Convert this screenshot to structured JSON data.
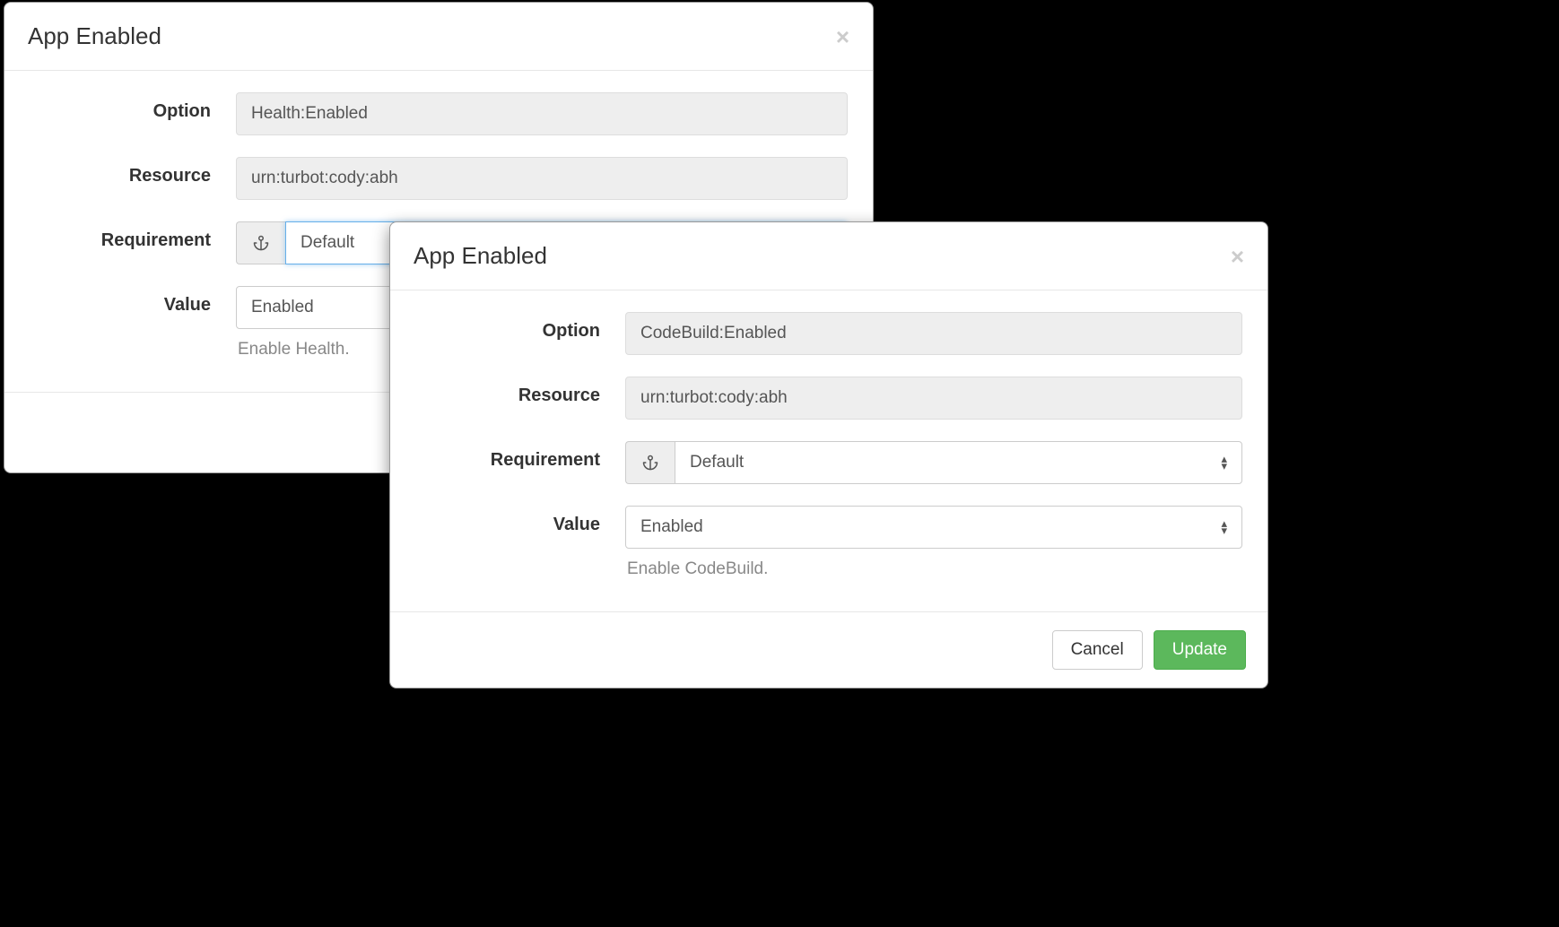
{
  "modal1": {
    "title": "App Enabled",
    "option_label": "Option",
    "option_value": "Health:Enabled",
    "resource_label": "Resource",
    "resource_value": "urn:turbot:cody:abh",
    "requirement_label": "Requirement",
    "requirement_value": "Default",
    "value_label": "Value",
    "value_value": "Enabled",
    "value_hint": "Enable Health."
  },
  "modal2": {
    "title": "App Enabled",
    "option_label": "Option",
    "option_value": "CodeBuild:Enabled",
    "resource_label": "Resource",
    "resource_value": "urn:turbot:cody:abh",
    "requirement_label": "Requirement",
    "requirement_value": "Default",
    "value_label": "Value",
    "value_value": "Enabled",
    "value_hint": "Enable CodeBuild.",
    "cancel_label": "Cancel",
    "update_label": "Update"
  }
}
